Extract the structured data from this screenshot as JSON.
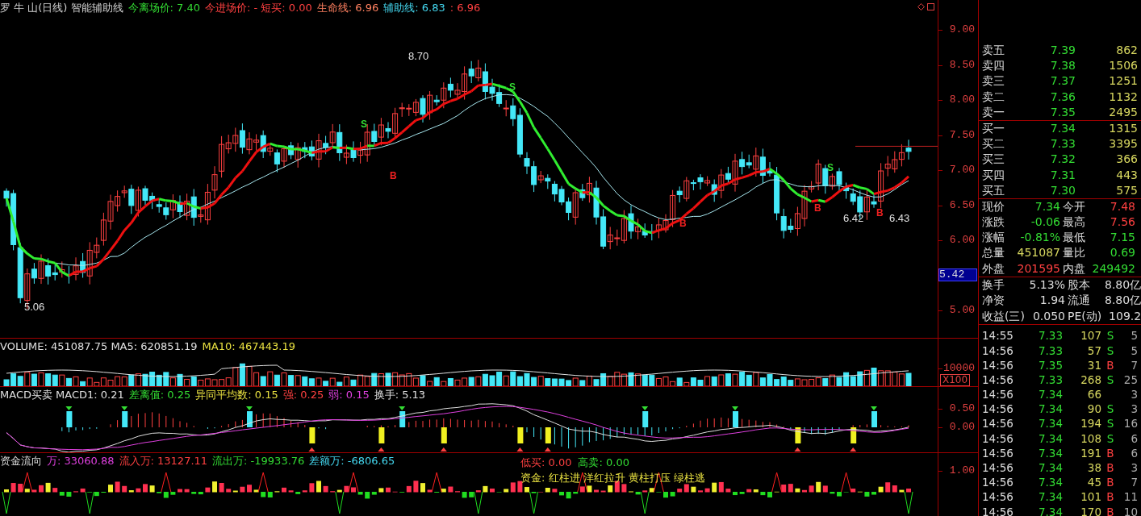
{
  "header": [
    {
      "text": "罗 牛 山(日线) 智能辅助线",
      "color": "#d0d0d0"
    },
    {
      "text": "今离场价: 7.40",
      "color": "#33dd33"
    },
    {
      "text": "今进场价: - 短买: 0.00",
      "color": "#ff4040"
    },
    {
      "text": "生命线: 6.96",
      "color": "#ff8060"
    },
    {
      "text": "辅助线: 6.83",
      "color": "#44d8f0"
    },
    {
      "text": ": 6.96",
      "color": "#ff4040"
    }
  ],
  "price_chart": {
    "annotations": [
      {
        "text": "8.70",
        "kind": "price"
      },
      {
        "text": "5.06",
        "kind": "price"
      },
      {
        "text": "6.42",
        "kind": "price"
      },
      {
        "text": "6.43",
        "kind": "price"
      },
      {
        "text": "S",
        "kind": "sell"
      },
      {
        "text": "S",
        "kind": "sell"
      },
      {
        "text": "S",
        "kind": "sell"
      },
      {
        "text": "B",
        "kind": "buy"
      },
      {
        "text": "B",
        "kind": "buy"
      },
      {
        "text": "B",
        "kind": "buy"
      },
      {
        "text": "B",
        "kind": "buy"
      }
    ],
    "axis": [
      "9.00",
      "8.50",
      "8.00",
      "7.50",
      "7.00",
      "6.50",
      "6.00",
      "5.00"
    ],
    "cursor_readout": "5.42"
  },
  "volume_chart": {
    "header": [
      {
        "text": "VOLUME: 451087.75 MA5: 620851.19",
        "color": "#e0e0e0"
      },
      {
        "text": "MA10: 467443.19",
        "color": "#e8e040"
      }
    ],
    "axis": [
      "10000"
    ],
    "unit": "X100"
  },
  "macd_chart": {
    "header": [
      {
        "text": "MACD买卖 MACD1: 0.21",
        "color": "#e0e0e0"
      },
      {
        "text": "差离值: 0.25",
        "color": "#33dd33"
      },
      {
        "text": "异同平均数: 0.15",
        "color": "#e8e040"
      },
      {
        "text": "强: 0.25",
        "color": "#ff4040"
      },
      {
        "text": "弱: 0.15",
        "color": "#e040e0"
      },
      {
        "text": "换手: 5.13",
        "color": "#e0e0e0"
      }
    ],
    "axis": [
      "0.50",
      "0.00"
    ]
  },
  "fund_chart": {
    "header": [
      {
        "text": "资金流向"
      },
      {
        "text": "万: 33060.88",
        "color": "#e040e0"
      },
      {
        "text": "流入万: 13127.11",
        "color": "#ff4040"
      },
      {
        "text": "流出万: -19933.76",
        "color": "#33dd33"
      },
      {
        "text": "差额万: -6806.65",
        "color": "#44d8f0"
      }
    ],
    "signals": [
      {
        "text": "低买: 0.00",
        "color": "#ff4040"
      },
      {
        "text": "高卖: 0.00",
        "color": "#33dd33"
      }
    ],
    "legend": "资金: 红柱进 洋红拉升 黄柱打压 绿柱逃",
    "axis": [
      "1.00"
    ]
  },
  "order_book": {
    "sell": [
      {
        "label": "卖五",
        "price": "7.39",
        "volume": "862"
      },
      {
        "label": "卖四",
        "price": "7.38",
        "volume": "1506"
      },
      {
        "label": "卖三",
        "price": "7.37",
        "volume": "1251"
      },
      {
        "label": "卖二",
        "price": "7.36",
        "volume": "1132"
      },
      {
        "label": "卖一",
        "price": "7.35",
        "volume": "2495"
      }
    ],
    "buy": [
      {
        "label": "买一",
        "price": "7.34",
        "volume": "1315"
      },
      {
        "label": "买二",
        "price": "7.33",
        "volume": "3395"
      },
      {
        "label": "买三",
        "price": "7.32",
        "volume": "366"
      },
      {
        "label": "买四",
        "price": "7.31",
        "volume": "443"
      },
      {
        "label": "买五",
        "price": "7.30",
        "volume": "575"
      }
    ]
  },
  "quotes": [
    {
      "label": "现价",
      "value": "7.34",
      "color": "#33dd33"
    },
    {
      "label": "今开",
      "value": "7.48",
      "color": "#ff4040"
    },
    {
      "label": "涨跌",
      "value": "-0.06",
      "color": "#33dd33"
    },
    {
      "label": "最高",
      "value": "7.56",
      "color": "#ff4040"
    },
    {
      "label": "涨幅",
      "value": "-0.81%",
      "color": "#33dd33"
    },
    {
      "label": "最低",
      "value": "7.15",
      "color": "#33dd33"
    },
    {
      "label": "总量",
      "value": "451087",
      "color": "#d8d860"
    },
    {
      "label": "量比",
      "value": "0.69",
      "color": "#33dd33"
    },
    {
      "label": "外盘",
      "value": "201595",
      "color": "#ff4040"
    },
    {
      "label": "内盘",
      "value": "249492",
      "color": "#33dd33"
    }
  ],
  "stats": [
    {
      "label": "换手",
      "value": "5.13%"
    },
    {
      "label": "股本",
      "value": "8.80亿"
    },
    {
      "label": "净资",
      "value": "1.94"
    },
    {
      "label": "流通",
      "value": "8.80亿"
    },
    {
      "label": "收益(三)",
      "value": "0.050"
    },
    {
      "label": "PE(动)",
      "value": "109.2"
    }
  ],
  "trades": [
    {
      "time": "14:55",
      "price": "7.33",
      "volume": "107",
      "side": "S",
      "color": "#33dd33",
      "count": "5"
    },
    {
      "time": "14:56",
      "price": "7.33",
      "volume": "57",
      "side": "S",
      "color": "#33dd33",
      "count": "5"
    },
    {
      "time": "14:56",
      "price": "7.35",
      "volume": "31",
      "side": "B",
      "color": "#ff4040",
      "count": "7"
    },
    {
      "time": "14:56",
      "price": "7.33",
      "volume": "268",
      "side": "S",
      "color": "#33dd33",
      "count": "25"
    },
    {
      "time": "14:56",
      "price": "7.34",
      "volume": "66",
      "count": "3"
    },
    {
      "time": "14:56",
      "price": "7.34",
      "volume": "90",
      "side": "S",
      "color": "#33dd33",
      "count": "3"
    },
    {
      "time": "14:56",
      "price": "7.34",
      "volume": "194",
      "side": "S",
      "color": "#33dd33",
      "count": "16"
    },
    {
      "time": "14:56",
      "price": "7.34",
      "volume": "108",
      "side": "S",
      "color": "#33dd33",
      "count": "6"
    },
    {
      "time": "14:56",
      "price": "7.34",
      "volume": "191",
      "side": "B",
      "color": "#ff4040",
      "count": "6"
    },
    {
      "time": "14:56",
      "price": "7.34",
      "volume": "38",
      "side": "B",
      "color": "#ff4040",
      "count": "3"
    },
    {
      "time": "14:56",
      "price": "7.34",
      "volume": "45",
      "side": "B",
      "color": "#ff4040",
      "count": "7"
    },
    {
      "time": "14:56",
      "price": "7.34",
      "volume": "101",
      "side": "B",
      "color": "#ff4040",
      "count": "11"
    },
    {
      "time": "14:56",
      "price": "7.34",
      "volume": "170",
      "side": "B",
      "color": "#ff4040",
      "count": "10"
    }
  ]
}
